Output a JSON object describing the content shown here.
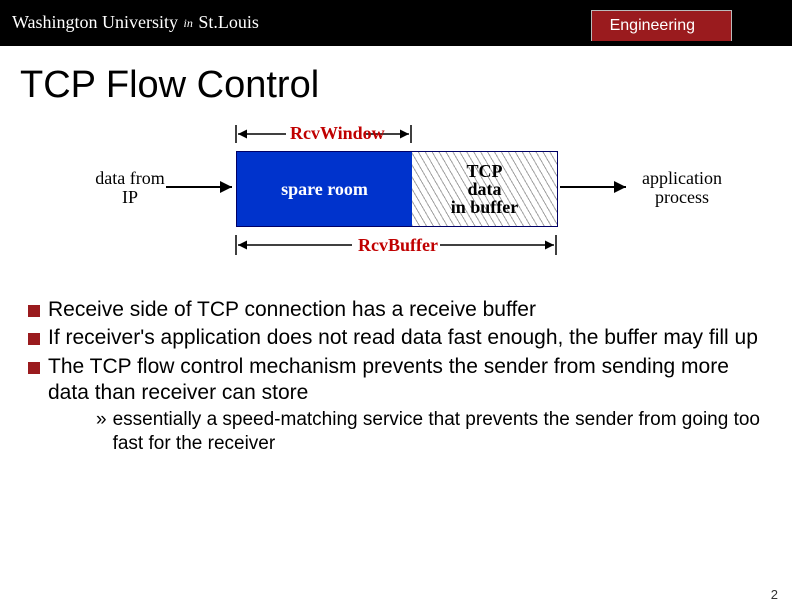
{
  "header": {
    "university": "Washington University in St.Louis",
    "school": "Engineering"
  },
  "title": "TCP Flow Control",
  "diagram": {
    "rcv_window": "RcvWindow",
    "rcv_buffer": "RcvBuffer",
    "data_from_ip": "data from\nIP",
    "spare_room": "spare room",
    "tcp_data": "TCP\ndata\nin buffer",
    "app_process": "application\nprocess"
  },
  "bullets": [
    "Receive side of TCP  connection has a receive buffer",
    "If receiver's application does not read data fast enough, the buffer may fill up",
    "The TCP flow control mechanism prevents the sender from sending more data than receiver can store"
  ],
  "sub_bullet": "essentially a speed-matching service that prevents the sender from going too fast for the receiver",
  "page_number": "2"
}
